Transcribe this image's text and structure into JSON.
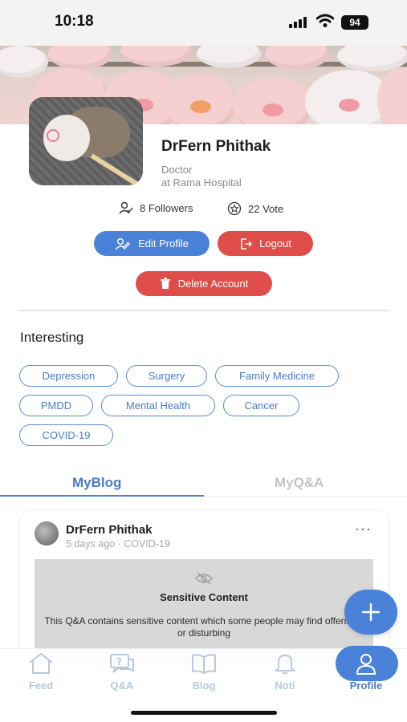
{
  "status_bar": {
    "time": "10:18",
    "battery": "94"
  },
  "profile": {
    "name": "DrFern Phithak",
    "role": "Doctor",
    "hospital": "at Rama Hospital",
    "followers": "8 Followers",
    "votes": "22 Vote"
  },
  "actions": {
    "edit_profile": "Edit Profile",
    "logout": "Logout",
    "delete_account": "Delete Account"
  },
  "interesting": {
    "title": "Interesting",
    "tags": [
      "Depression",
      "Surgery",
      "Family Medicine",
      "PMDD",
      "Mental Health",
      "Cancer",
      "COVID-19"
    ]
  },
  "tabs": {
    "active": "MyBlog",
    "inactive": "MyQ&A"
  },
  "post": {
    "author": "DrFern Phithak",
    "meta": "5 days ago · COVID-19",
    "more": "···",
    "sensitive_title": "Sensitive Content",
    "sensitive_text": "This Q&A contains sensitive content which some people may find offensive or disturbing"
  },
  "fab": {
    "icon": "plus-icon"
  },
  "nav": {
    "feed": "Feed",
    "qa": "Q&A",
    "blog": "Blog",
    "noti": "Noti",
    "profile": "Profile"
  },
  "colors": {
    "primary": "#4b82d9",
    "danger": "#df4d4b",
    "chip_text": "#4b7bc9",
    "nav_inactive": "#b9c8de"
  }
}
